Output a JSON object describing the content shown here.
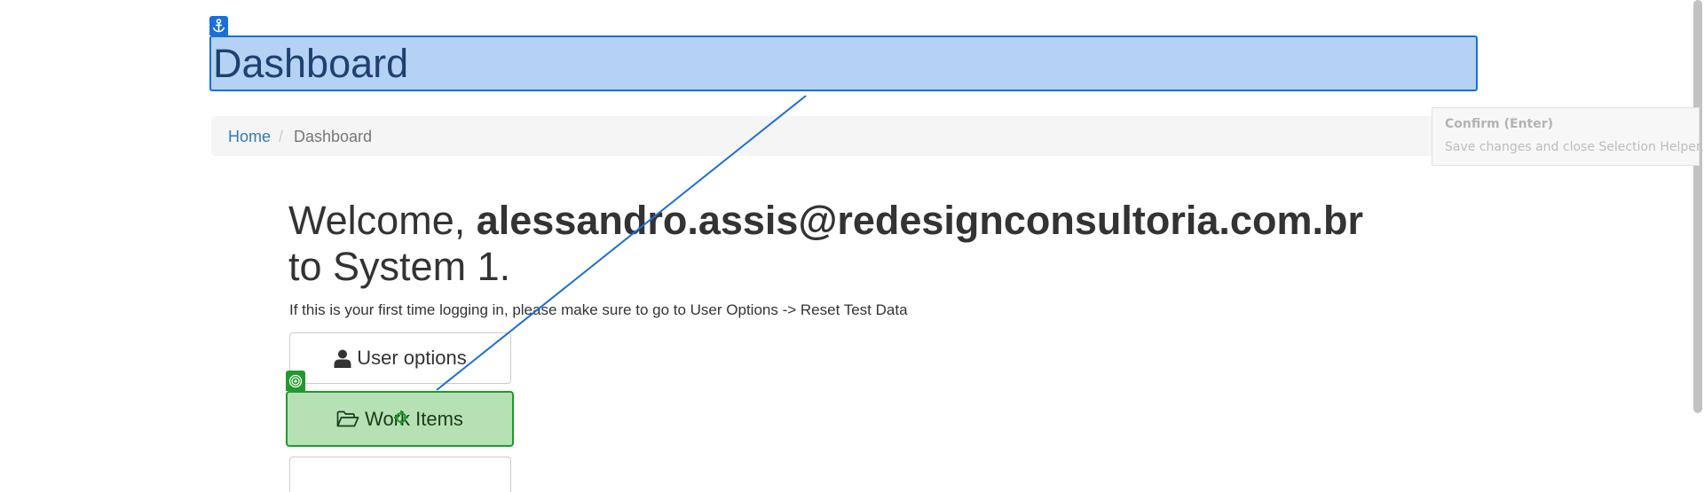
{
  "page": {
    "title": "Dashboard"
  },
  "breadcrumb": {
    "home": "Home",
    "separator": "/",
    "current": "Dashboard"
  },
  "welcome": {
    "prefix": "Welcome, ",
    "user": "alessandro.assis@redesignconsultoria.com.br",
    "suffix": "to System 1."
  },
  "intro": {
    "text": "If this is your first time logging in, please make sure to go to User Options -> Reset Test Data"
  },
  "buttons": {
    "user_options": "User options",
    "work_items": "Work Items",
    "third": ""
  },
  "helper": {
    "title": "Confirm (Enter)",
    "description": "Save changes and close Selection Helper."
  },
  "icons": {
    "anchor": "anchor-icon",
    "target": "target-icon",
    "user": "user-icon",
    "folder": "folder-open-icon",
    "cursor": "crosshair-cursor-icon"
  },
  "colors": {
    "anchor_highlight": "#1a6fd8",
    "target_highlight": "#1f9a2c",
    "link": "#337ab7"
  }
}
